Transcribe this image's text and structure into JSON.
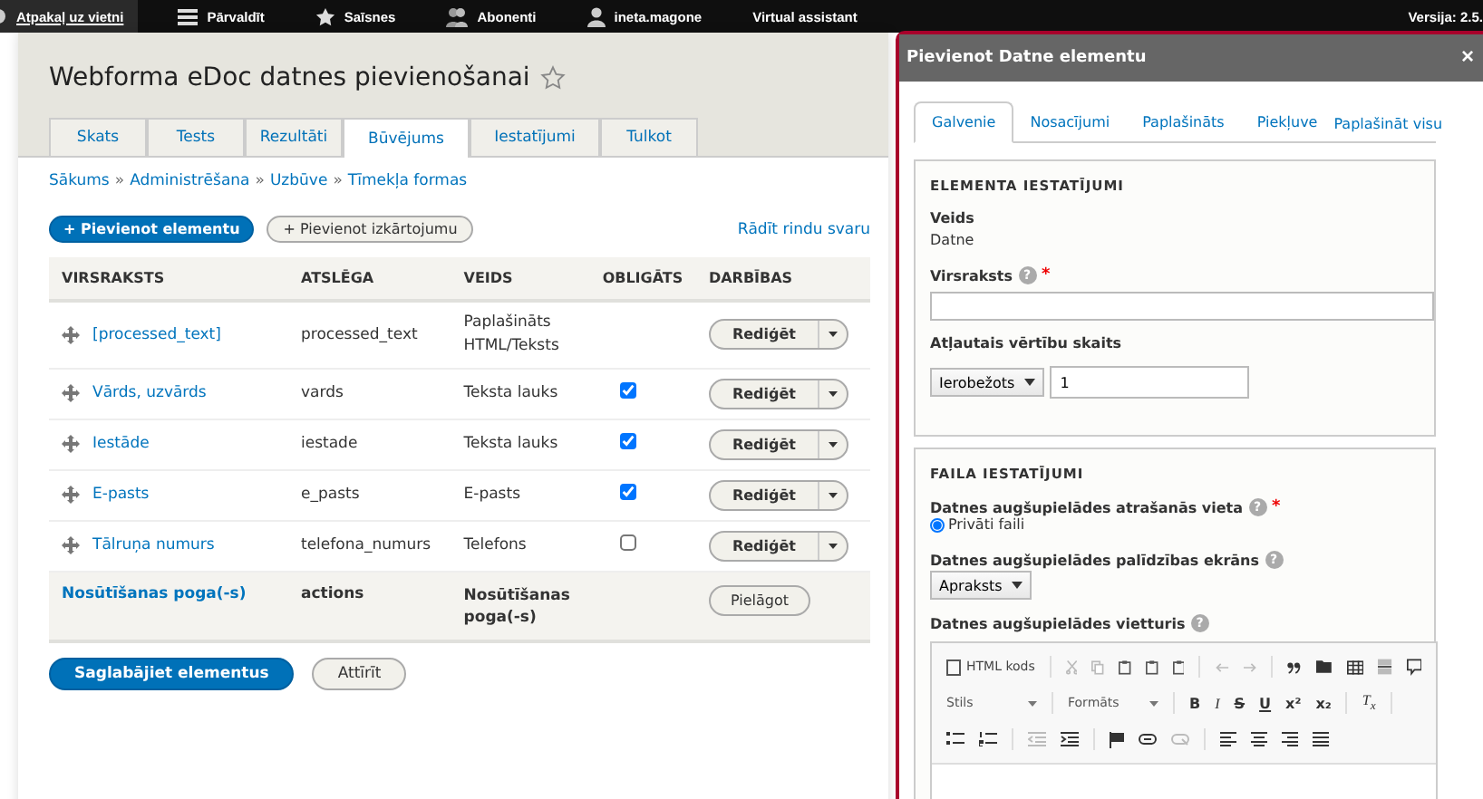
{
  "toolbar": {
    "items": [
      {
        "kind": "back",
        "label": "Atpakaļ uz vietni"
      },
      {
        "kind": "menu",
        "label": "Pārvaldīt"
      },
      {
        "kind": "star",
        "label": "Saīsnes"
      },
      {
        "kind": "people",
        "label": "Abonenti"
      },
      {
        "kind": "user",
        "label": "ineta.magone"
      },
      {
        "kind": "plain",
        "label": "Virtual assistant"
      }
    ],
    "version": "Versija: 2.5."
  },
  "page": {
    "title": "Webforma eDoc datnes pievienošanai",
    "tabs": [
      {
        "label": "Skats",
        "selected": false
      },
      {
        "label": "Tests",
        "selected": false
      },
      {
        "label": "Rezultāti",
        "selected": false
      },
      {
        "label": "Būvējums",
        "selected": true
      },
      {
        "label": "Iestatījumi",
        "selected": false
      },
      {
        "label": "Tulkot",
        "selected": false
      }
    ],
    "breadcrumb": [
      "Sākums",
      "Administrēšana",
      "Uzbūve",
      "Tīmekļa formas"
    ],
    "breadcrumb_separator": "»",
    "add_element": "+ Pievienot elementu",
    "add_layout": "+ Pievienot izkārtojumu",
    "show_weights": "Rādīt rindu svaru",
    "table": {
      "columns": [
        "VIRSRAKSTS",
        "ATSLĒGA",
        "VEIDS",
        "OBLIGĀTS",
        "DARBĪBAS"
      ],
      "rows": [
        {
          "kind": "element",
          "title": "[processed_text]",
          "key": "processed_text",
          "type": "Paplašināts HTML/Teksts",
          "action": "Rediģēt"
        },
        {
          "kind": "element",
          "title": "Vārds, uzvārds",
          "key": "vards",
          "type": "Teksta lauks",
          "required": true,
          "action": "Rediģēt"
        },
        {
          "kind": "element",
          "title": "Iestāde",
          "key": "iestade",
          "type": "Teksta lauks",
          "required": true,
          "action": "Rediģēt"
        },
        {
          "kind": "element",
          "title": "E-pasts",
          "key": "e_pasts",
          "type": "E-pasts",
          "required": true,
          "action": "Rediģēt"
        },
        {
          "kind": "element",
          "title": "Tālruņa numurs",
          "key": "telefona_numurs",
          "type": "Telefons",
          "required": false,
          "action": "Rediģēt"
        },
        {
          "kind": "actions",
          "title": "Nosūtīšanas poga(-s)",
          "key": "actions",
          "type": "Nosūtīšanas poga(-s)",
          "action": "Pielāgot"
        }
      ]
    },
    "save": "Saglabājiet elementus",
    "reset": "Attīrīt"
  },
  "dialog": {
    "title": "Pievienot Datne elementu",
    "close": "×",
    "tabs": [
      {
        "label": "Galvenie",
        "selected": true
      },
      {
        "label": "Nosacījumi",
        "selected": false
      },
      {
        "label": "Paplašināts",
        "selected": false
      },
      {
        "label": "Piekļuve",
        "selected": false
      }
    ],
    "expand_all": "Paplašināt visu",
    "element_settings": {
      "legend": "ELEMENTA IESTATĪJUMI",
      "type_label": "Veids",
      "type_value": "Datne",
      "title_label": "Virsraksts",
      "title_help": "?",
      "title_required": "*",
      "count_label": "Atļautais vērtību skaits",
      "count_select": "Ierobežots",
      "count_value": "1"
    },
    "file_settings": {
      "legend": "FAILA IESTATĪJUMI",
      "location_label": "Datnes augšupielādes atrašanās vieta",
      "location_help": "?",
      "location_required": "*",
      "location_options": [
        {
          "label": "Privāti faili",
          "selected": true
        }
      ],
      "help_label": "Datnes augšupielādes palīdzības ekrāns",
      "help_help": "?",
      "help_select": "Apraksts",
      "placeholder_label": "Datnes augšupielādes vietturis",
      "placeholder_help": "?",
      "editor": {
        "source": "HTML kods",
        "styles": "Stils",
        "format": "Formāts",
        "format_buttons": [
          "B",
          "I",
          "S",
          "U",
          "x²",
          "x₂"
        ],
        "clear_format": "T$_{x}$"
      }
    }
  }
}
